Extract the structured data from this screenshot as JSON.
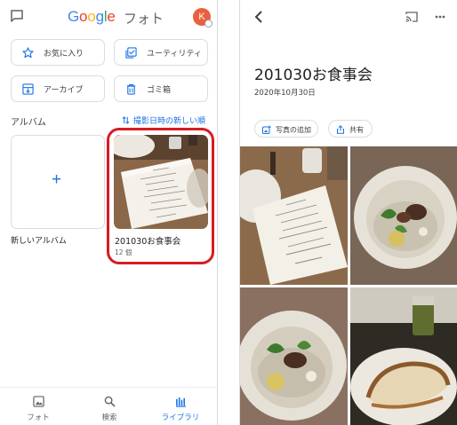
{
  "left_screen": {
    "header": {
      "logo_letters": [
        "G",
        "o",
        "o",
        "g",
        "l",
        "e"
      ],
      "logo_suffix": "フォト",
      "avatar_initial": "K",
      "icons": [
        "chat-icon",
        "account-avatar"
      ]
    },
    "utility_buttons": [
      {
        "label": "お気に入り",
        "icon": "star-icon"
      },
      {
        "label": "ユーティリティ",
        "icon": "utilities-icon"
      },
      {
        "label": "アーカイブ",
        "icon": "archive-icon"
      },
      {
        "label": "ゴミ箱",
        "icon": "trash-icon"
      }
    ],
    "albums_section": {
      "title": "アルバム",
      "sort_label": "撮影日時の新しい順"
    },
    "new_album": {
      "plus": "+",
      "label": "新しいアルバム"
    },
    "album": {
      "title": "201030お食事会",
      "count": "12 個"
    },
    "bottom_nav": [
      {
        "label": "フォト",
        "icon": "photo-icon",
        "active": false
      },
      {
        "label": "検索",
        "icon": "search-icon",
        "active": false
      },
      {
        "label": "ライブラリ",
        "icon": "library-icon",
        "active": true
      }
    ]
  },
  "right_screen": {
    "album_title": "201030お食事会",
    "album_date": "2020年10月30日",
    "chips": [
      {
        "label": "写真の追加",
        "icon": "add-photo-icon"
      },
      {
        "label": "共有",
        "icon": "share-icon"
      }
    ],
    "icons": [
      "back-arrow-icon",
      "cast-icon",
      "more-vert-icon"
    ]
  },
  "colors": {
    "accent_blue": "#1a73e8",
    "highlight_red": "#d81b22",
    "avatar_orange": "#e8603c",
    "border_gray": "#dadce0"
  }
}
